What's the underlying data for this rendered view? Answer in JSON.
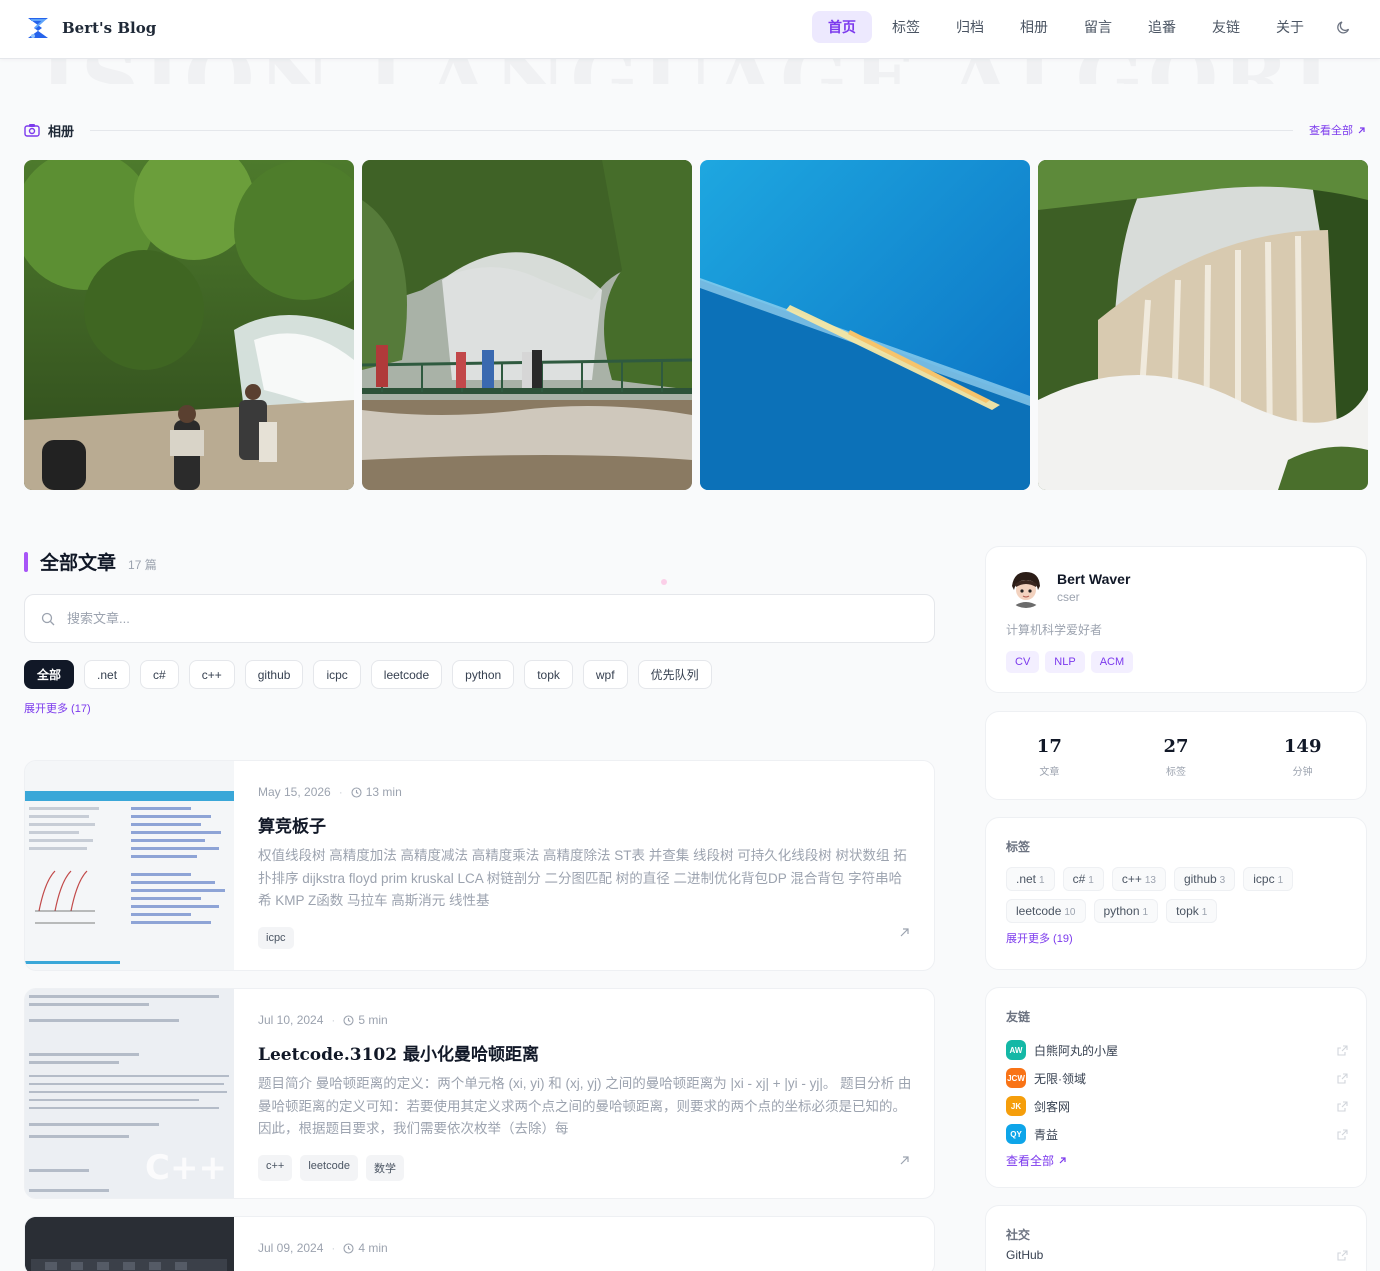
{
  "site": {
    "name": "Bert's Blog"
  },
  "nav": {
    "items": [
      "首页",
      "标签",
      "归档",
      "相册",
      "留言",
      "追番",
      "友链",
      "关于"
    ]
  },
  "watermark": "ISION  LANGUAGE  ALGORI",
  "album": {
    "title": "相册",
    "view_all": "查看全部"
  },
  "articles": {
    "title": "全部文章",
    "count": "17 篇",
    "search_placeholder": "搜索文章...",
    "filters": [
      "全部",
      ".net",
      "c#",
      "c++",
      "github",
      "icpc",
      "leetcode",
      "python",
      "topk",
      "wpf",
      "优先队列"
    ],
    "expand": "展开更多 (17)"
  },
  "posts": [
    {
      "date": "May 15, 2026",
      "read": "13 min",
      "title": "算竞板子",
      "excerpt": "权值线段树 高精度加法 高精度减法 高精度乘法 高精度除法 ST表 并查集 线段树 可持久化线段树 树状数组 拓扑排序 dijkstra floyd prim kruskal LCA 树链剖分 二分图匹配 树的直径 二进制优化背包DP 混合背包 字符串哈希 KMP Z函数 马拉车 高斯消元 线性基",
      "tags": [
        "icpc"
      ]
    },
    {
      "date": "Jul 10, 2024",
      "read": "5 min",
      "title": "Leetcode.3102 最小化曼哈顿距离",
      "excerpt": "题目简介 曼哈顿距离的定义：两个单元格 (xi, yi) 和 (xj, yj) 之间的曼哈顿距离为 |xi - xj| + |yi - yj|。 题目分析 由曼哈顿距离的定义可知：若要使用其定义求两个点之间的曼哈顿距离，则要求的两个点的坐标必须是已知的。因此，根据题目要求，我们需要依次枚举（去除）每",
      "tags": [
        "c++",
        "leetcode",
        "数学"
      ]
    },
    {
      "date": "Jul 09, 2024",
      "read": "4 min"
    }
  ],
  "profile": {
    "name": "Bert Waver",
    "role": "cser",
    "bio": "计算机科学爱好者",
    "tags": [
      "CV",
      "NLP",
      "ACM"
    ]
  },
  "stats": [
    {
      "num": "17",
      "label": "文章"
    },
    {
      "num": "27",
      "label": "标签"
    },
    {
      "num": "149",
      "label": "分钟"
    }
  ],
  "tag_cloud": {
    "title": "标签",
    "items": [
      {
        "name": ".net",
        "count": "1"
      },
      {
        "name": "c#",
        "count": "1"
      },
      {
        "name": "c++",
        "count": "13"
      },
      {
        "name": "github",
        "count": "3"
      },
      {
        "name": "icpc",
        "count": "1"
      },
      {
        "name": "leetcode",
        "count": "10"
      },
      {
        "name": "python",
        "count": "1"
      },
      {
        "name": "topk",
        "count": "1"
      }
    ],
    "more": "展开更多 (19)"
  },
  "friends": {
    "title": "友链",
    "items": [
      {
        "abbr": "AW",
        "name": "白熊阿丸的小屋",
        "color": "#14b8a6"
      },
      {
        "abbr": "JCW",
        "name": "无限·领域",
        "color": "#f97316"
      },
      {
        "abbr": "JK",
        "name": "剑客网",
        "color": "#f59e0b"
      },
      {
        "abbr": "QY",
        "name": "青益",
        "color": "#0ea5e9"
      }
    ],
    "more": "查看全部"
  },
  "social": {
    "title": "社交",
    "items": [
      "GitHub"
    ]
  },
  "colors": {
    "accent": "#7c3aed",
    "accent_bg": "#ede9fe"
  }
}
